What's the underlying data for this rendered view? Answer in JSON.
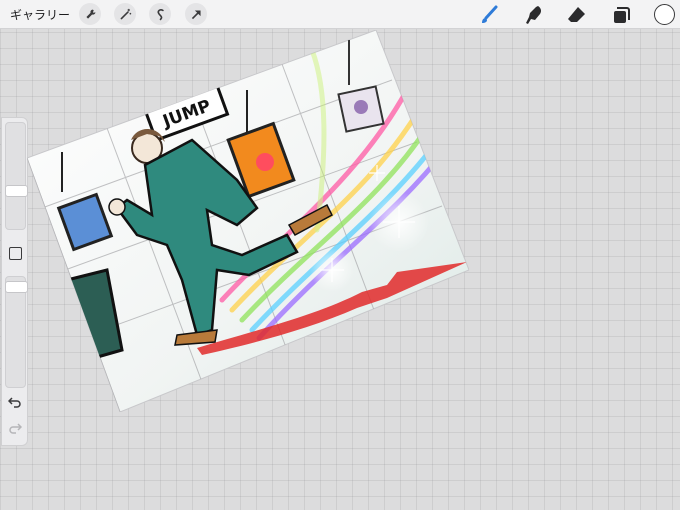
{
  "toolbar": {
    "gallery_label": "ギャラリー",
    "left_icons": [
      "wrench-icon",
      "magic-wand-icon",
      "selection-icon",
      "transform-arrow-icon"
    ],
    "right_icons": [
      "brush-icon",
      "smudge-icon",
      "eraser-icon",
      "layers-icon"
    ],
    "accent_color": "#2e7bd8",
    "current_color": "#ffffff"
  },
  "sidebar": {
    "brush_size_level": 0.55,
    "opacity_level": 0.0,
    "icons": [
      "modify-square-icon",
      "undo-icon",
      "redo-icon"
    ]
  },
  "artwork": {
    "sign_text": "JUMP",
    "colors": {
      "suit": "#2f8a7e",
      "rainbow": [
        "#ff5aa5",
        "#ffd24a",
        "#8fe35a",
        "#5ad0ff",
        "#9b6bff"
      ],
      "slash": "#e02a2a"
    }
  }
}
